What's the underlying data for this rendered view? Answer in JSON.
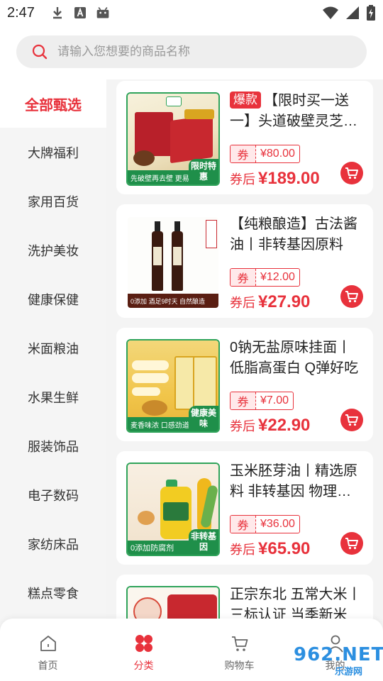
{
  "status_bar": {
    "time": "2:47"
  },
  "search": {
    "placeholder": "请输入您想要的商品名称"
  },
  "sidebar": {
    "items": [
      {
        "label": "全部甄选",
        "active": true
      },
      {
        "label": "大牌福利"
      },
      {
        "label": "家用百货"
      },
      {
        "label": "洗护美妆"
      },
      {
        "label": "健康保健"
      },
      {
        "label": "米面粮油"
      },
      {
        "label": "水果生鲜"
      },
      {
        "label": "服装饰品"
      },
      {
        "label": "电子数码"
      },
      {
        "label": "家纺床品"
      },
      {
        "label": "糕点零食"
      }
    ]
  },
  "products": [
    {
      "hot_badge": "爆款",
      "title": "【限时买一送一】头道破壁灵芝孢子粉",
      "coupon_label": "券",
      "coupon_value": "¥80.00",
      "price_prefix": "券后",
      "price": "¥189.00",
      "thumb_banner": "先破壁再去壁 更易吸收",
      "thumb_tag": "限时特惠"
    },
    {
      "title": "【纯粮酿造】古法酱油丨非转基因原料",
      "coupon_label": "券",
      "coupon_value": "¥12.00",
      "price_prefix": "券后",
      "price": "¥27.90",
      "thumb_banner": "0添加  酒足9时天  自然酿造"
    },
    {
      "title": "0钠无盐原味挂面丨低脂高蛋白 Q弹好吃",
      "coupon_label": "券",
      "coupon_value": "¥7.00",
      "price_prefix": "券后",
      "price": "¥22.90",
      "thumb_banner": "麦香味浓  口感劲道",
      "thumb_tag": "健康美味"
    },
    {
      "title": "玉米胚芽油丨精选原料 非转基因 物理压榨",
      "coupon_label": "券",
      "coupon_value": "¥36.00",
      "price_prefix": "券后",
      "price": "¥65.90",
      "thumb_banner": "0添加防腐剂",
      "thumb_tag": "非转基因"
    },
    {
      "title": "正宗东北 五常大米丨三标认证 当季新米"
    }
  ],
  "bottom_nav": {
    "items": [
      {
        "label": "首页"
      },
      {
        "label": "分类",
        "active": true
      },
      {
        "label": "购物车"
      },
      {
        "label": "我的"
      }
    ]
  },
  "watermark": {
    "text": "962.NET",
    "sub": "乐游网"
  },
  "colors": {
    "accent": "#e8323c",
    "thumb_green": "#1f8f4a",
    "watermark_blue": "#2c8fe0"
  }
}
